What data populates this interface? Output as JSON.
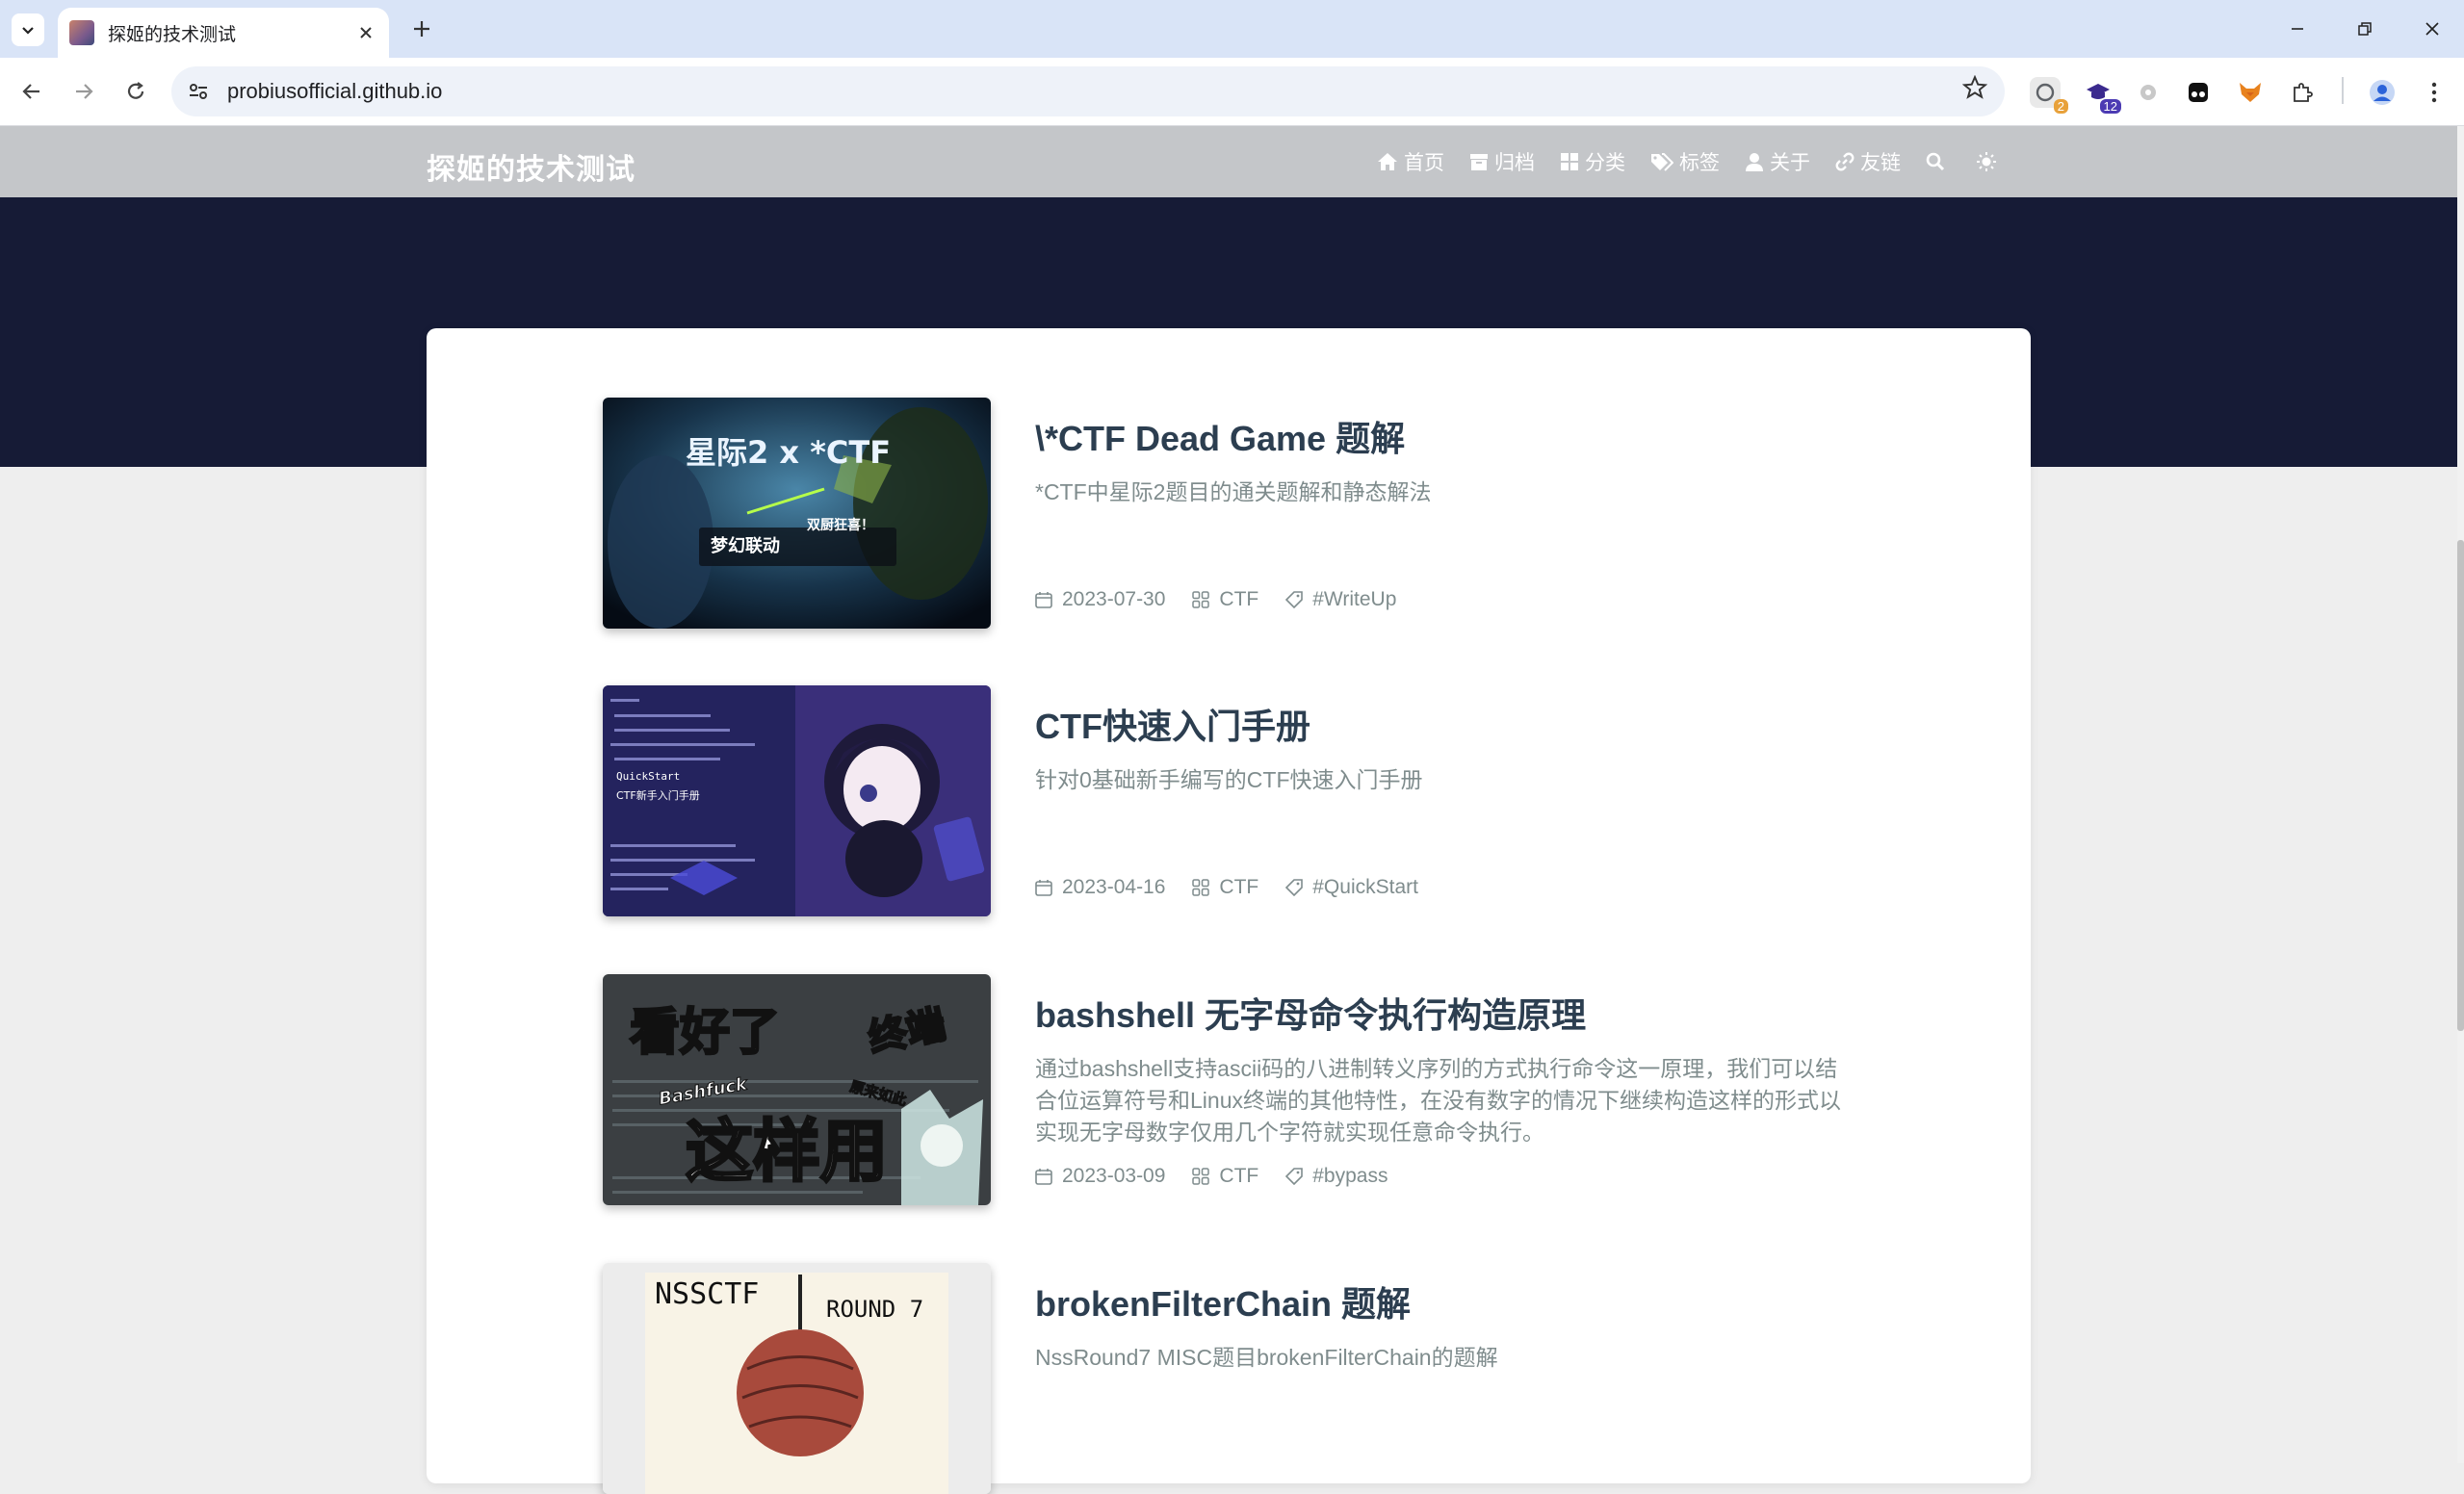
{
  "browser": {
    "tab_title": "探姬的技术测试",
    "url": "probiusofficial.github.io",
    "extensions": [
      {
        "name": "extension-1",
        "badge": "2",
        "color": "#5f6368",
        "badge_color": "#e8a13a"
      },
      {
        "name": "extension-2",
        "badge": "12",
        "color": "#3b2a8e",
        "badge_color": "#4c3bb3"
      }
    ]
  },
  "site": {
    "title": "探姬的技术测试",
    "menu": [
      {
        "label": "首页",
        "icon": "home-icon"
      },
      {
        "label": "归档",
        "icon": "archive-icon"
      },
      {
        "label": "分类",
        "icon": "category-icon"
      },
      {
        "label": "标签",
        "icon": "tags-icon"
      },
      {
        "label": "关于",
        "icon": "user-icon"
      },
      {
        "label": "友链",
        "icon": "link-icon"
      }
    ]
  },
  "posts": [
    {
      "title": "\\*CTF Dead Game 题解",
      "description": "*CTF中星际2题目的通关题解和静态解法",
      "date": "2023-07-30",
      "category": "CTF",
      "tag": "#WriteUp",
      "thumb_text": [
        "星际2 x *CTF",
        "梦幻联动",
        "双厨狂喜！"
      ]
    },
    {
      "title": "CTF快速入门手册",
      "description": "针对0基础新手编写的CTF快速入门手册",
      "date": "2023-04-16",
      "category": "CTF",
      "tag": "#QuickStart",
      "thumb_text": [
        "QuickStart",
        "CTF新手入门手册"
      ]
    },
    {
      "title": "bashshell 无字母命令执行构造原理",
      "description": "通过bashshell支持ascii码的八进制转义序列的方式执行命令这一原理，我们可以结合位运算符号和Linux终端的其他特性，在没有数字的情况下继续构造这样的形式以实现无字母数字仅用几个字符就实现任意命令执行。",
      "date": "2023-03-09",
      "category": "CTF",
      "tag": "#bypass",
      "thumb_text": [
        "看好了",
        "终端",
        "Bashfuck",
        "这样用",
        "原来如此"
      ]
    },
    {
      "title": "brokenFilterChain 题解",
      "description": "NssRound7 MISC题目brokenFilterChain的题解",
      "date": "",
      "category": "",
      "tag": "",
      "thumb_text": [
        "NSSCTF",
        "ROUND 7"
      ]
    }
  ]
}
